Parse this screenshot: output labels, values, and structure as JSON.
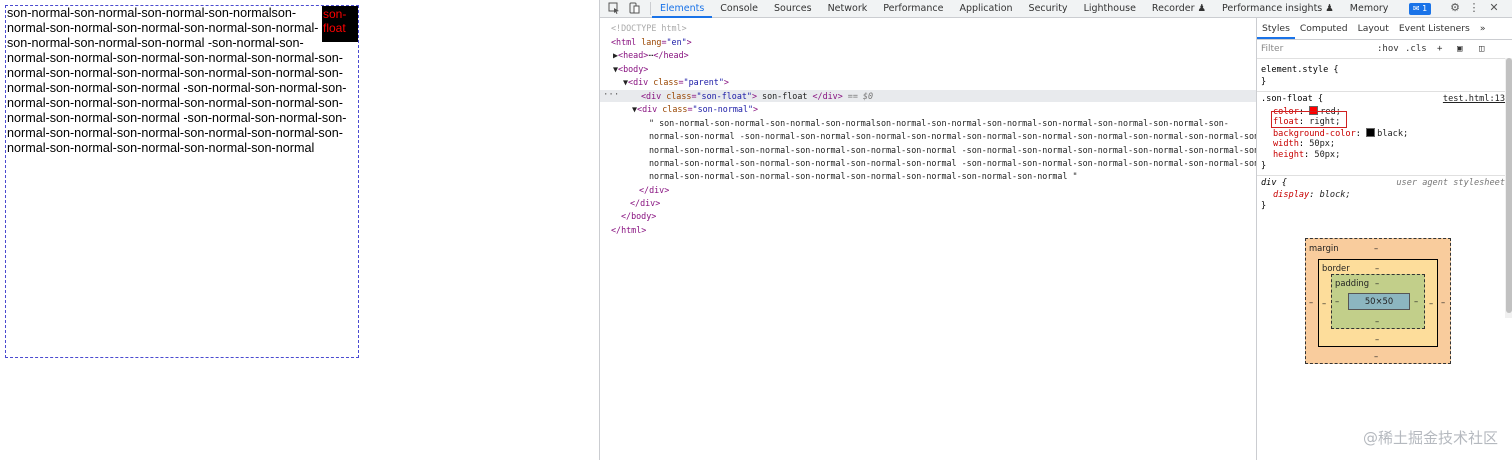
{
  "preview": {
    "float_text_line1": "son-",
    "float_text_line2": "float",
    "normal_lines": [
      "son-normal-son-normal-son-normal-son-normalson-",
      "normal-son-normal-son-normal-son-normal-son-normal-",
      "son-normal-son-normal-son-normal -son-normal-son-",
      "normal-son-normal-son-normal-son-normal-son-normal-son-",
      "normal-son-normal-son-normal-son-normal-son-normal-son-",
      "normal-son-normal-son-normal -son-normal-son-normal-son-",
      "normal-son-normal-son-normal-son-normal-son-normal-son-",
      "normal-son-normal-son-normal -son-normal-son-normal-son-",
      "normal-son-normal-son-normal-son-normal-son-normal-son-",
      "normal-son-normal-son-normal-son-normal-son-normal"
    ]
  },
  "devtools": {
    "tabs": [
      "Elements",
      "Console",
      "Sources",
      "Network",
      "Performance",
      "Application",
      "Security",
      "Lighthouse",
      "Recorder ♟",
      "Performance insights ♟",
      "Memory"
    ],
    "active_tab": "Elements",
    "issues_badge": "1",
    "tree": {
      "doctype": "<!DOCTYPE html>",
      "html_open": "<html",
      "html_attr": "lang",
      "html_val": "\"en\"",
      "head_line": "<head>",
      "head_close": "</head>",
      "body_open": "<body>",
      "div_open": "<div",
      "class_attr": "class",
      "parent_val": "\"parent\"",
      "float_val": "\"son-float\"",
      "float_text": "son-float",
      "div_close": "</div>",
      "selected_marker": "== $0",
      "normal_val": "\"son-normal\"",
      "normal_text_lines": [
        "\" son-normal-son-normal-son-normal-son-normalson-normal-son-normal-son-normal-son-normal-son-normal-son-normal-son-",
        "normal-son-normal -son-normal-son-normal-son-normal-son-normal-son-normal-son-normal-son-normal-son-normal-son-normal-son-",
        "normal-son-normal-son-normal-son-normal-son-normal-son-normal -son-normal-son-normal-son-normal-son-normal-son-normal-son-",
        "normal-son-normal-son-normal-son-normal-son-normal-son-normal -son-normal-son-normal-son-normal-son-normal-son-normal-son-",
        "normal-son-normal-son-normal-son-normal-son-normal-son-normal-son-normal-son-normal \""
      ],
      "body_close": "</body>",
      "html_close": "</html>"
    },
    "styles_tabs": [
      "Styles",
      "Computed",
      "Layout",
      "Event Listeners",
      "»"
    ],
    "filter_placeholder": "Filter",
    "hov": ":hov",
    "cls": ".cls",
    "rules": {
      "element_style": "element.style {",
      "close": "}",
      "son_float_selector": ".son-float {",
      "son_float_source": "test.html:13",
      "color_prop": "color",
      "color_val": "red;",
      "float_prop": "float",
      "float_val": "right;",
      "bg_prop": "background-color",
      "bg_val": "black;",
      "width_prop": "width",
      "width_val": "50px;",
      "height_prop": "height",
      "height_val": "50px;",
      "div_selector": "div {",
      "ua_label": "user agent stylesheet",
      "display_prop": "display",
      "display_val": "block;"
    },
    "box_model": {
      "margin_label": "margin",
      "border_label": "border",
      "padding_label": "padding",
      "content": "50×50",
      "dash": "–"
    }
  },
  "watermark": "@稀土掘金技术社区",
  "colors": {
    "accent": "#1a73e8",
    "float_text": "#ff0000",
    "highlight_box": "#d02020"
  }
}
